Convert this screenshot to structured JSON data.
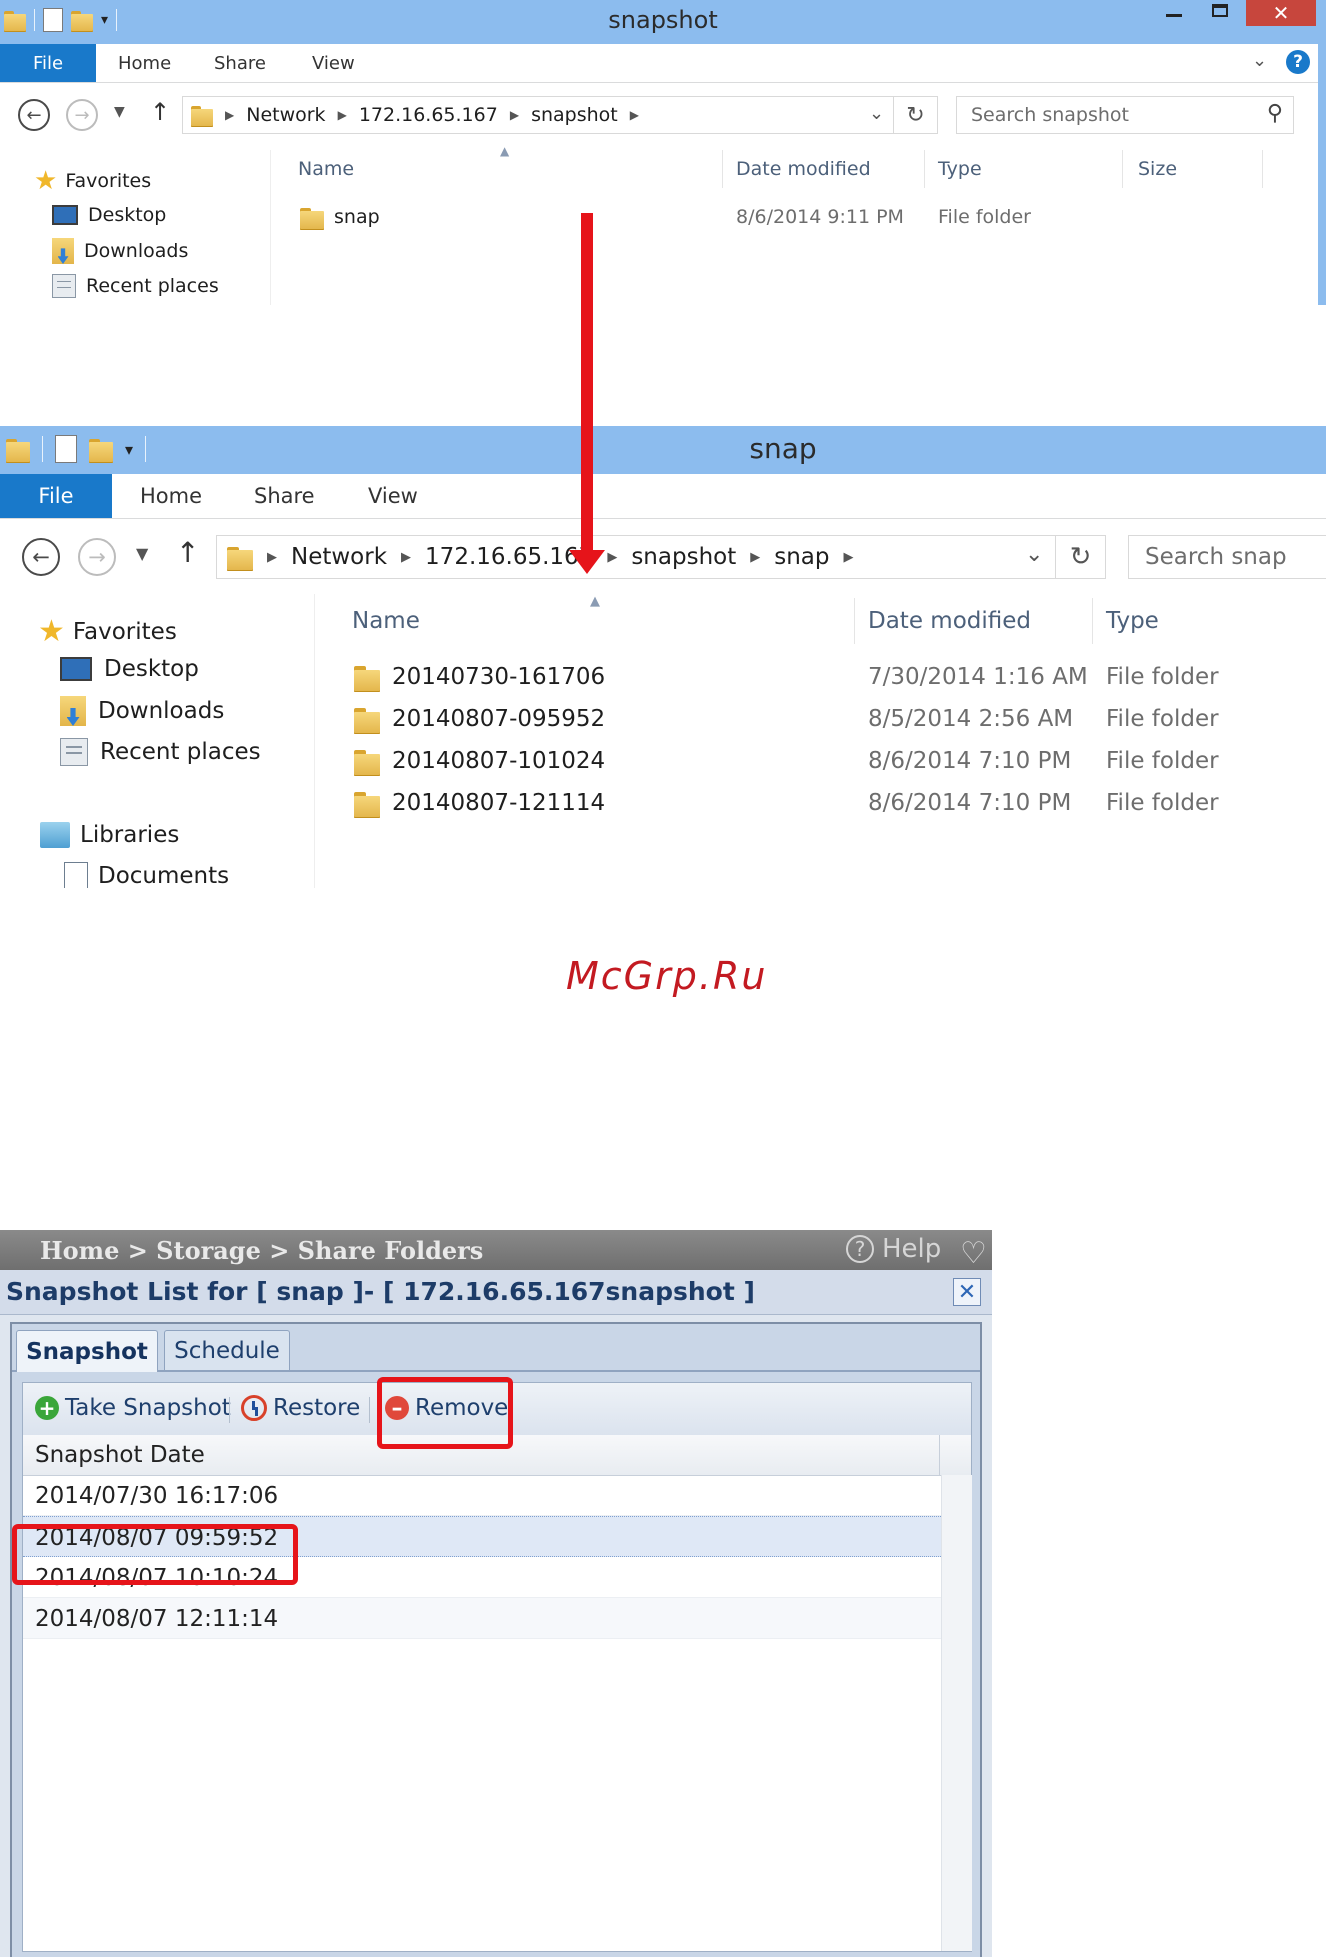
{
  "window1": {
    "title": "snapshot",
    "ribbon_tabs": [
      "File",
      "Home",
      "Share",
      "View"
    ],
    "breadcrumb": [
      "Network",
      "172.16.65.167",
      "snapshot"
    ],
    "search_placeholder": "Search snapshot",
    "nav_items": [
      "Favorites",
      "Desktop",
      "Downloads",
      "Recent places"
    ],
    "columns": [
      "Name",
      "Date modified",
      "Type",
      "Size"
    ],
    "files": [
      {
        "name": "snap",
        "date": "8/6/2014 9:11 PM",
        "type": "File folder"
      }
    ]
  },
  "window2": {
    "title": "snap",
    "ribbon_tabs": [
      "File",
      "Home",
      "Share",
      "View"
    ],
    "breadcrumb": [
      "Network",
      "172.16.65.167",
      "snapshot",
      "snap"
    ],
    "search_placeholder": "Search snap",
    "nav_items": [
      "Favorites",
      "Desktop",
      "Downloads",
      "Recent places",
      "Libraries",
      "Documents"
    ],
    "columns": [
      "Name",
      "Date modified",
      "Type"
    ],
    "files": [
      {
        "name": "20140730-161706",
        "date": "7/30/2014 1:16 AM",
        "type": "File folder"
      },
      {
        "name": "20140807-095952",
        "date": "8/5/2014 2:56 AM",
        "type": "File folder"
      },
      {
        "name": "20140807-101024",
        "date": "8/6/2014 7:10 PM",
        "type": "File folder"
      },
      {
        "name": "20140807-121114",
        "date": "8/6/2014 7:10 PM",
        "type": "File folder"
      }
    ]
  },
  "watermark": "McGrp.Ru",
  "nas": {
    "breadcrumb": "Home > Storage > Share Folders",
    "help_label": "Help",
    "panel_title": "Snapshot List for [ snap ]- [ 172.16.65.167snapshot ]",
    "tabs": [
      "Snapshot",
      "Schedule"
    ],
    "toolbar": {
      "take_snapshot": "Take Snapshot",
      "restore": "Restore",
      "remove": "Remove"
    },
    "column_header": "Snapshot Date",
    "snapshots": [
      "2014/07/30 16:17:06",
      "2014/08/07 09:59:52",
      "2014/08/07 10:10:24",
      "2014/08/07 12:11:14"
    ],
    "selected_index": 1
  },
  "colors": {
    "titlebar": "#8cbcee",
    "file_tab": "#1979ca",
    "annotation_red": "#e6141a",
    "watermark": "#c31a21"
  }
}
